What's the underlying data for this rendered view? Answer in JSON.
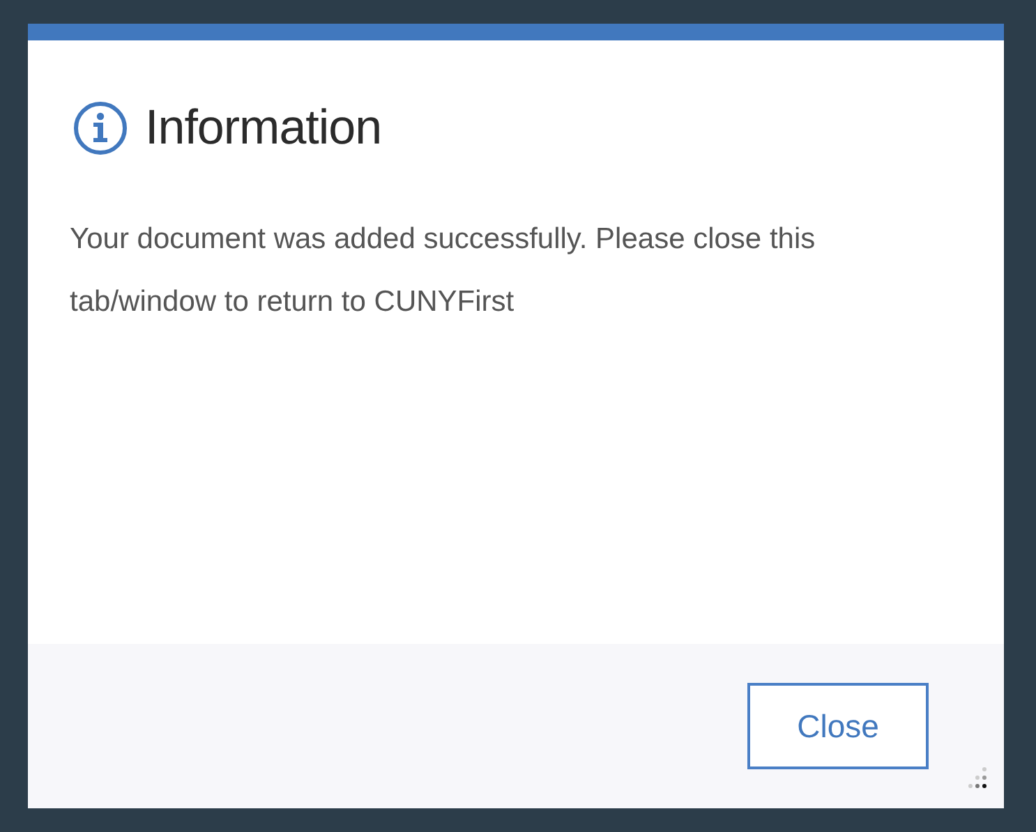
{
  "dialog": {
    "title": "Information",
    "message": "Your document was added successfully. Please close this tab/window to return to CUNYFirst",
    "buttons": [
      "Close"
    ]
  }
}
